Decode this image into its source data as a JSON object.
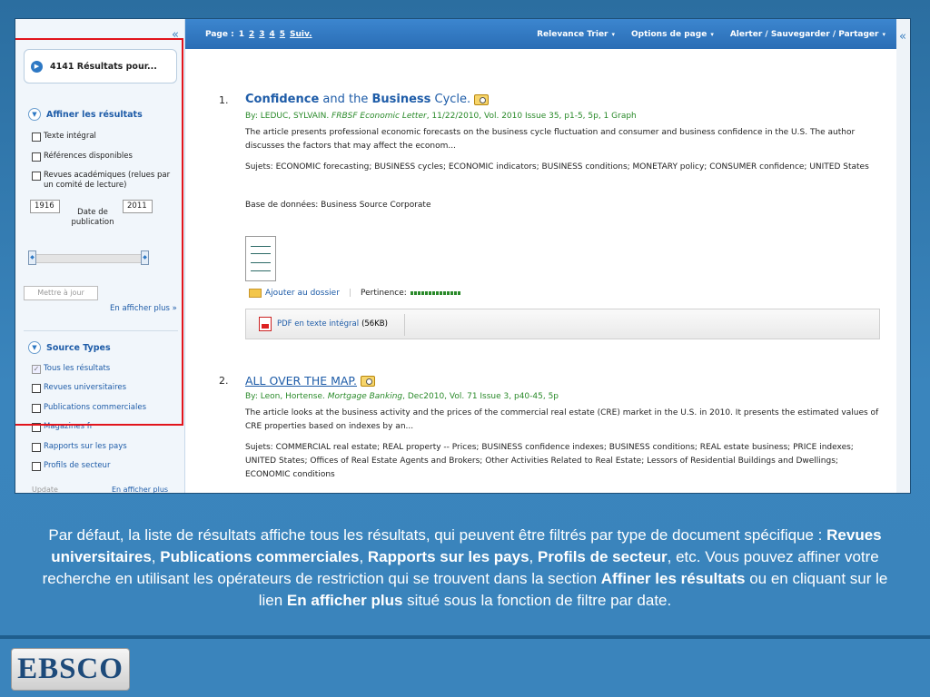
{
  "sidebar": {
    "collapse_glyph": "«",
    "results_count": "4141 Résultats pour...",
    "refine": {
      "title": "Affiner les résultats",
      "options": [
        "Texte intégral",
        "Références disponibles",
        "Revues académiques (relues par un comité de lecture)"
      ],
      "date_from": "1916",
      "date_to": "2011",
      "date_label": "Date de publication",
      "update_button": "Mettre à jour",
      "more_link": "En afficher plus »"
    },
    "source_types": {
      "title": "Source Types",
      "options": [
        "Tous les résultats",
        "Revues universitaires",
        "Publications commerciales",
        "Magazines fr",
        "Rapports sur les pays",
        "Profils de secteur"
      ],
      "update_button": "Update",
      "more_link": "En afficher plus"
    }
  },
  "toolbar": {
    "page_label": "Page :",
    "pages": [
      "1",
      "2",
      "3",
      "4",
      "5"
    ],
    "next": "Suiv.",
    "sort": "Relevance Trier",
    "page_options": "Options de page",
    "alert": "Alerter / Sauvegarder / Partager",
    "collapse_glyph": "«"
  },
  "results": [
    {
      "number": "1.",
      "title_parts": [
        "Confidence",
        " and the ",
        "Business",
        " Cycle."
      ],
      "by_prefix": "By: LEDUC, SYLVAIN. ",
      "source": "FRBSF Economic Letter",
      "meta_rest": ", 11/22/2010, Vol. 2010 Issue 35, p1-5, 5p, 1 Graph",
      "abstract": "The article presents professional economic forecasts on the business cycle fluctuation and consumer and business confidence in the U.S. The author discusses the factors that may affect the econom...",
      "subjects": "Sujets: ECONOMIC forecasting; BUSINESS cycles; ECONOMIC indicators; BUSINESS conditions; MONETARY policy; CONSUMER confidence; UNITED States",
      "database": "Base de données: Business Source Corporate",
      "add_folder": "Ajouter au dossier",
      "relevance_label": "Pertinence:",
      "relevance_level": 1.0,
      "pdf_link": "PDF en texte intégral",
      "pdf_size": "(56KB)"
    },
    {
      "number": "2.",
      "title": "ALL OVER THE MAP.",
      "by_prefix": "By: Leon, Hortense. ",
      "source": "Mortgage Banking",
      "meta_rest": ", Dec2010, Vol. 71 Issue 3, p40-45, 5p",
      "abstract": "The article looks at the business activity and the prices of the commercial real estate (CRE) market in the U.S. in 2010. It presents the estimated values of CRE properties based on indexes by an...",
      "subjects": "Sujets: COMMERCIAL real estate; REAL property -- Prices; BUSINESS confidence indexes; BUSINESS conditions; REAL estate business; PRICE indexes; UNITED States; Offices of Real Estate Agents and Brokers; Other Activities Related to Real Estate; Lessors of Residential Buildings and Dwellings; ECONOMIC conditions"
    }
  ],
  "caption": {
    "p1": "Par défaut, la liste de résultats affiche tous les résultats, qui peuvent être filtrés par type de document spécifique : ",
    "b1": "Revues universitaires",
    "c1": ", ",
    "b2": "Publications commerciales",
    "c2": ", ",
    "b3": "Rapports sur les pays",
    "c3": ", ",
    "b4": "Profils de secteur",
    "p2": ", etc. Vous pouvez affiner votre recherche en utilisant les opérateurs de restriction qui se trouvent dans la section ",
    "b5": "Affiner les résultats",
    "p3": " ou en cliquant sur le lien ",
    "b6": "En afficher plus",
    "p4": " situé sous la fonction de filtre par date."
  },
  "logo": "EBSCO"
}
